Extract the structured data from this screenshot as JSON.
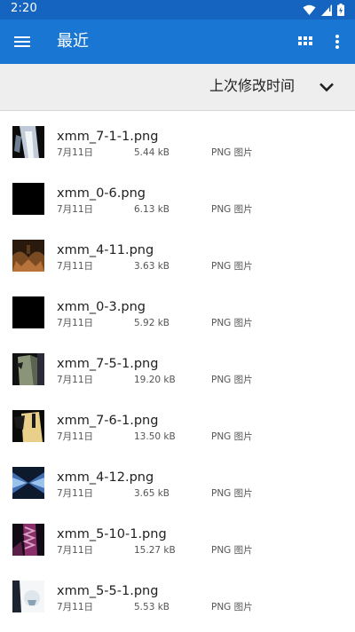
{
  "status_bar": {
    "time": "2:20"
  },
  "app_bar": {
    "title": "最近"
  },
  "sort_bar": {
    "label": "上次修改时间"
  },
  "files": [
    {
      "name": "xmm_7-1-1.png",
      "date": "7月11日",
      "size": "5.44 kB",
      "type": "PNG 图片"
    },
    {
      "name": "xmm_0-6.png",
      "date": "7月11日",
      "size": "6.13 kB",
      "type": "PNG 图片"
    },
    {
      "name": "xmm_4-11.png",
      "date": "7月11日",
      "size": "3.63 kB",
      "type": "PNG 图片"
    },
    {
      "name": "xmm_0-3.png",
      "date": "7月11日",
      "size": "5.92 kB",
      "type": "PNG 图片"
    },
    {
      "name": "xmm_7-5-1.png",
      "date": "7月11日",
      "size": "19.20 kB",
      "type": "PNG 图片"
    },
    {
      "name": "xmm_7-6-1.png",
      "date": "7月11日",
      "size": "13.50 kB",
      "type": "PNG 图片"
    },
    {
      "name": "xmm_4-12.png",
      "date": "7月11日",
      "size": "3.65 kB",
      "type": "PNG 图片"
    },
    {
      "name": "xmm_5-10-1.png",
      "date": "7月11日",
      "size": "15.27 kB",
      "type": "PNG 图片"
    },
    {
      "name": "xmm_5-5-1.png",
      "date": "7月11日",
      "size": "5.53 kB",
      "type": "PNG 图片"
    }
  ],
  "colors": {
    "status_bar": "#1565c0",
    "app_bar": "#1976d2",
    "sort_bar": "#eeeeee"
  },
  "icons": [
    "menu-icon",
    "grid-view-icon",
    "more-vert-icon",
    "chevron-down-icon",
    "wifi-icon",
    "signal-icon",
    "battery-icon"
  ]
}
